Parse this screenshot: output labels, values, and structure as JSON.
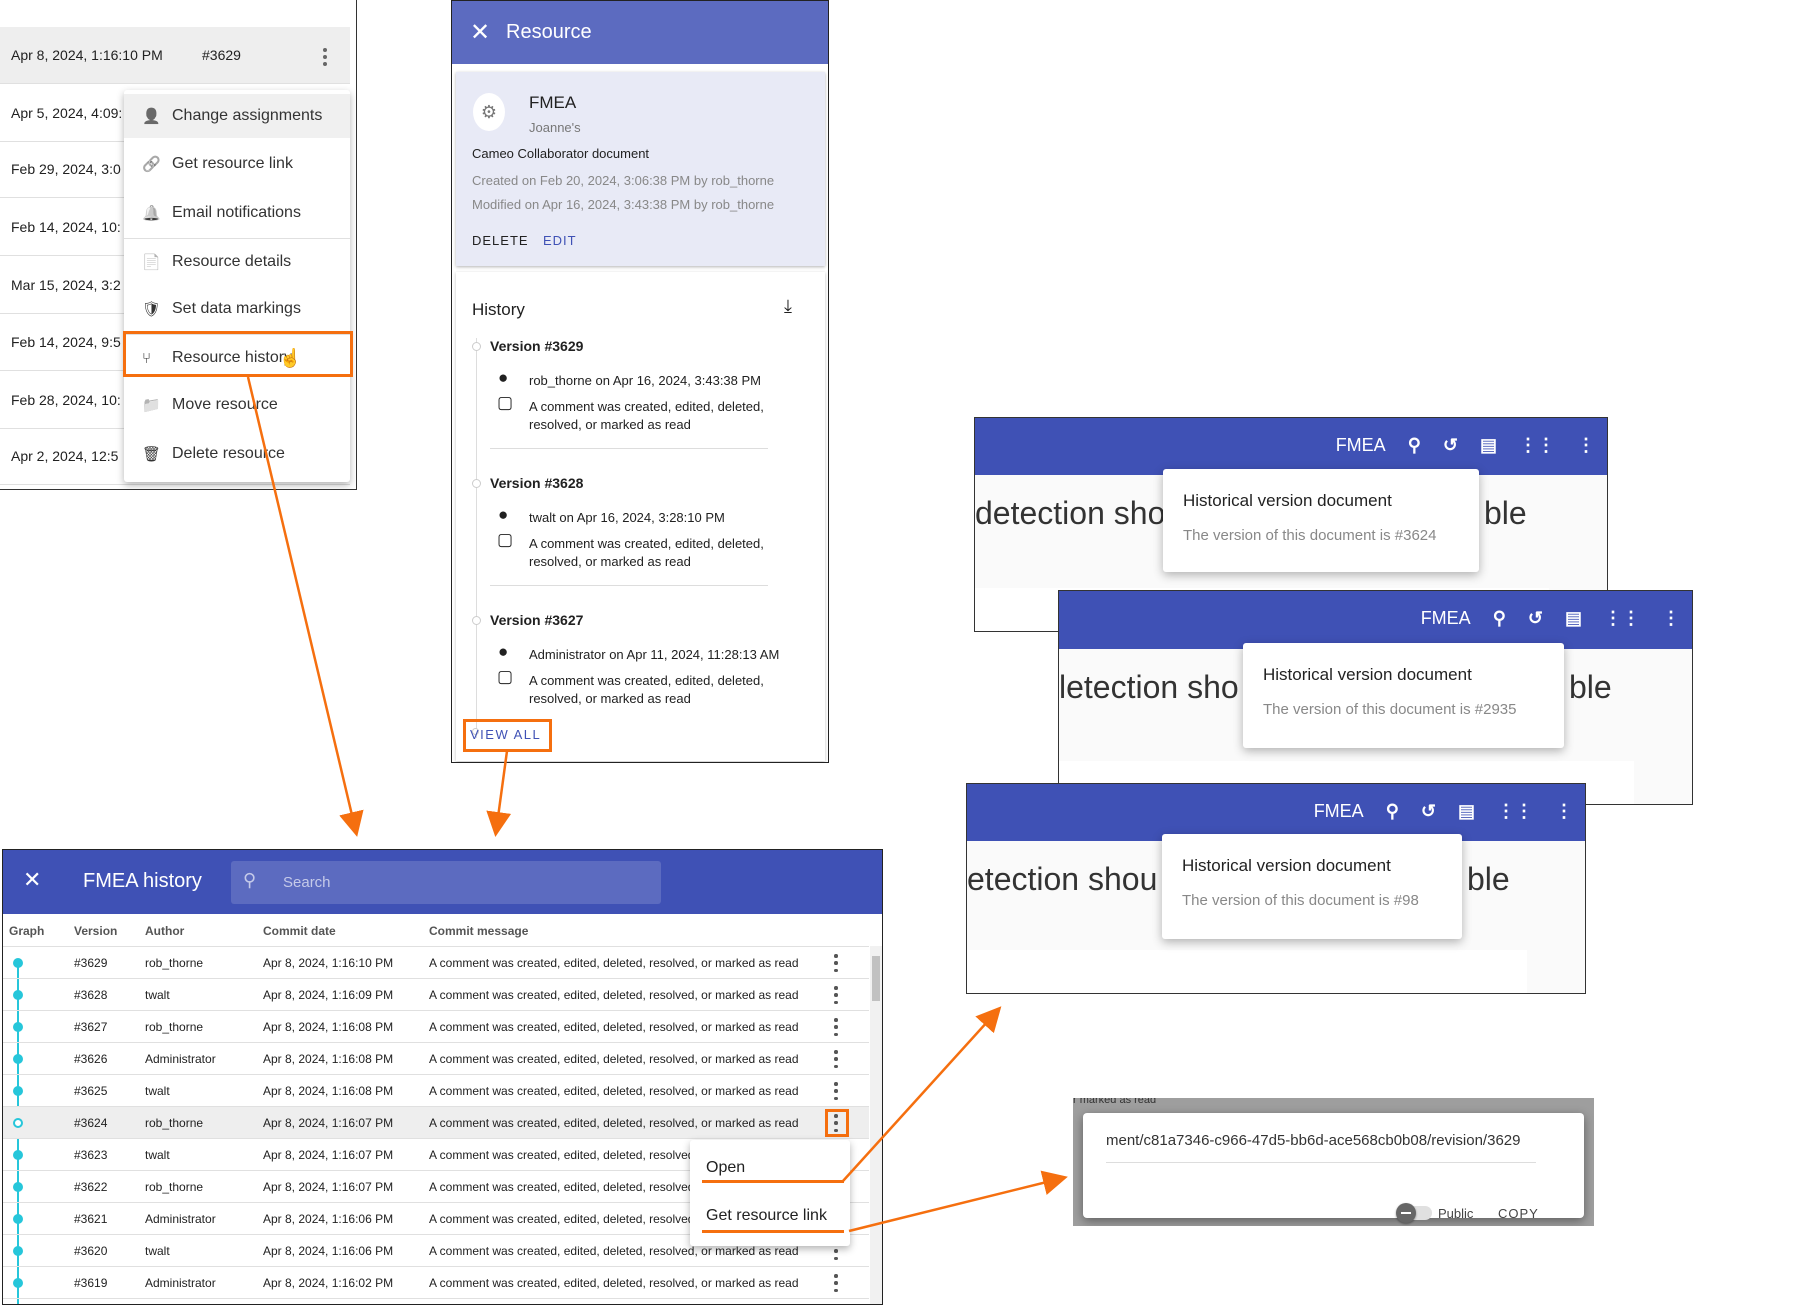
{
  "colors": {
    "accent": "#f56f0f",
    "header": "#3f51b5",
    "header_light": "#5c6bc0",
    "graph": "#26c6da"
  },
  "resource_list": {
    "rows": [
      {
        "date": "Apr 8, 2024, 1:16:10 PM",
        "version": "#3629"
      },
      {
        "date": "Apr 5, 2024, 4:09:"
      },
      {
        "date": "Feb 29, 2024, 3:0"
      },
      {
        "date": "Feb 14, 2024, 10:"
      },
      {
        "date": "Mar 15, 2024, 3:2"
      },
      {
        "date": "Feb 14, 2024, 9:5"
      },
      {
        "date": "Feb 28, 2024, 10:"
      },
      {
        "date": "Apr 2, 2024, 12:5"
      }
    ],
    "menu": [
      {
        "label": "Change assignments",
        "icon": "user-edit-icon"
      },
      {
        "label": "Get resource link",
        "icon": "link-icon"
      },
      {
        "label": "Email notifications",
        "icon": "bell-icon"
      },
      {
        "label": "Resource details",
        "icon": "file-info-icon"
      },
      {
        "label": "Set data markings",
        "icon": "shield-icon"
      },
      {
        "label": "Resource history",
        "icon": "branch-icon"
      },
      {
        "label": "Move resource",
        "icon": "folder-move-icon"
      },
      {
        "label": "Delete resource",
        "icon": "trash-icon"
      }
    ]
  },
  "resource_panel": {
    "title": "Resource",
    "name": "FMEA",
    "owner": "Joanne's",
    "type": "Cameo Collaborator document",
    "created": "Created on Feb 20, 2024, 3:06:38 PM by rob_thorne",
    "modified": "Modified on Apr 16, 2024, 3:43:38 PM by rob_thorne",
    "delete_label": "DELETE",
    "edit_label": "EDIT",
    "history_title": "History",
    "versions": [
      {
        "title": "Version #3629",
        "author": "rob_thorne on Apr 16, 2024, 3:43:38 PM",
        "msg1": "A comment was created, edited, deleted,",
        "msg2": "resolved, or marked as read"
      },
      {
        "title": "Version #3628",
        "author": "twalt on Apr 16, 2024, 3:28:10 PM",
        "msg1": "A comment was created, edited, deleted,",
        "msg2": "resolved, or marked as read"
      },
      {
        "title": "Version #3627",
        "author": "Administrator on Apr 11, 2024, 11:28:13 AM",
        "msg1": "A comment was created, edited, deleted,",
        "msg2": "resolved, or marked as read"
      }
    ],
    "view_all_label": "VIEW ALL"
  },
  "history_table": {
    "title": "FMEA history",
    "search_placeholder": "Search",
    "columns": [
      "Graph",
      "Version",
      "Author",
      "Commit date",
      "Commit message"
    ],
    "rows": [
      {
        "version": "#3629",
        "author": "rob_thorne",
        "date": "Apr 8, 2024, 1:16:10 PM",
        "message": "A comment was created, edited, deleted, resolved, or marked as read"
      },
      {
        "version": "#3628",
        "author": "twalt",
        "date": "Apr 8, 2024, 1:16:09 PM",
        "message": "A comment was created, edited, deleted, resolved, or marked as read"
      },
      {
        "version": "#3627",
        "author": "rob_thorne",
        "date": "Apr 8, 2024, 1:16:08 PM",
        "message": "A comment was created, edited, deleted, resolved, or marked as read"
      },
      {
        "version": "#3626",
        "author": "Administrator",
        "date": "Apr 8, 2024, 1:16:08 PM",
        "message": "A comment was created, edited, deleted, resolved, or marked as read"
      },
      {
        "version": "#3625",
        "author": "twalt",
        "date": "Apr 8, 2024, 1:16:08 PM",
        "message": "A comment was created, edited, deleted, resolved, or marked as read"
      },
      {
        "version": "#3624",
        "author": "rob_thorne",
        "date": "Apr 8, 2024, 1:16:07 PM",
        "message": "A comment was created, edited, deleted, resolved, or marked as read"
      },
      {
        "version": "#3623",
        "author": "twalt",
        "date": "Apr 8, 2024, 1:16:07 PM",
        "message": "A comment was created, edited, deleted, resolved, or marked as read"
      },
      {
        "version": "#3622",
        "author": "rob_thorne",
        "date": "Apr 8, 2024, 1:16:07 PM",
        "message": "A comment was created, edited, deleted, resolved, or marked as read"
      },
      {
        "version": "#3621",
        "author": "Administrator",
        "date": "Apr 8, 2024, 1:16:06 PM",
        "message": "A comment was created, edited, deleted, resolved, or marked as read"
      },
      {
        "version": "#3620",
        "author": "twalt",
        "date": "Apr 8, 2024, 1:16:06 PM",
        "message": "A comment was created, edited, deleted, resolved, or marked as read"
      },
      {
        "version": "#3619",
        "author": "Administrator",
        "date": "Apr 8, 2024, 1:16:02 PM",
        "message": "A comment was created, edited, deleted, resolved, or marked as read"
      }
    ],
    "selected_index": 5,
    "context_menu": [
      "Open",
      "Get resource link"
    ]
  },
  "doc_views": [
    {
      "app": "FMEA",
      "bg_left": "detection sho",
      "bg_right": "ble",
      "popup_title": "Historical version document",
      "popup_text": "The version of this document is #3624"
    },
    {
      "app": "FMEA",
      "bg_left": "letection sho",
      "bg_right": "ble",
      "popup_title": "Historical version document",
      "popup_text": "The version of this document is #2935"
    },
    {
      "app": "FMEA",
      "bg_left": "etection shou",
      "bg_right": "ble",
      "popup_title": "Historical version document",
      "popup_text": "The version of this document is #98"
    }
  ],
  "link_dialog": {
    "url": "ment/c81a7346-c966-47d5-bb6d-ace568cb0b08/revision/3629",
    "public_label": "Public",
    "copy_label": "COPY",
    "bg_text": "r marked as read"
  }
}
